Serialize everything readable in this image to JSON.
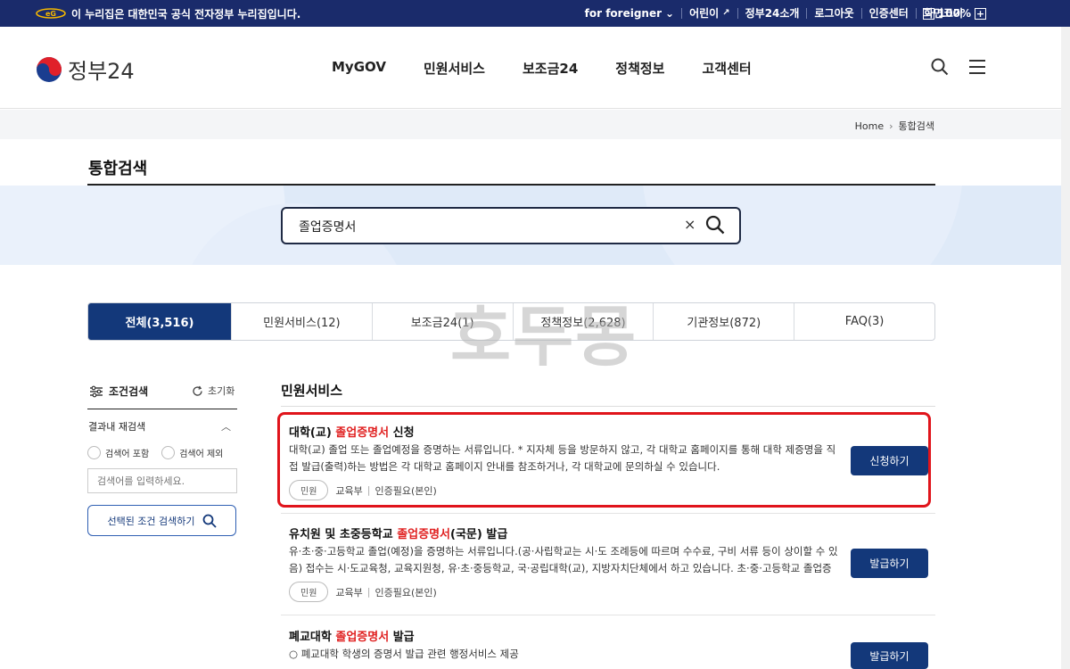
{
  "topbar": {
    "notice": "이 누리집은 대한민국 공식 전자정부 누리집입니다.",
    "links": [
      "for foreigner",
      "어린이",
      "정부24소개",
      "로그아웃",
      "인증센터",
      "화면크기"
    ],
    "zoom_minus": "−",
    "zoom_value": "100%",
    "zoom_plus": "+"
  },
  "header": {
    "logo_text": "정부24",
    "nav": [
      "MyGOV",
      "민원서비스",
      "보조금24",
      "정책정보",
      "고객센터"
    ]
  },
  "breadcrumb": [
    "Home",
    "통합검색"
  ],
  "page_title": "통합검색",
  "search": {
    "value": "졸업증명서",
    "clear": "×"
  },
  "tabs": [
    {
      "label": "전체(3,516)",
      "active": true
    },
    {
      "label": "민원서비스(12)",
      "active": false
    },
    {
      "label": "보조금24(1)",
      "active": false
    },
    {
      "label": "정책정보(2,628)",
      "active": false
    },
    {
      "label": "기관정보(872)",
      "active": false
    },
    {
      "label": "FAQ(3)",
      "active": false
    }
  ],
  "watermark": "호두몽",
  "sidebar": {
    "heading": "조건검색",
    "reset": "초기화",
    "subheading": "결과내 재검색",
    "option_include": "검색어 포함",
    "option_exclude": "검색어 제외",
    "input_placeholder": "검색어를 입력하세요.",
    "submit": "선택된 조건 검색하기"
  },
  "results": {
    "heading": "민원서비스",
    "items": [
      {
        "title_pre": "대학(교) ",
        "title_hl": "졸업증명서",
        "title_post": " 신청",
        "desc": "대학(교) 졸업 또는 졸업예정을 증명하는 서류입니다. * 지자체 등을 방문하지 않고, 각 대학교 홈페이지를 통해 대학 제증명을 직접 발급(출력)하는 방법은 각 대학교 홈페이지 안내를 참조하거나, 각 대학교에 문의하실 수 있습니다.",
        "badge": "민원",
        "org": "교육부",
        "auth": "인증필요(본인)",
        "button": "신청하기"
      },
      {
        "title_pre": "유치원 및 초중등학교 ",
        "title_hl": "졸업증명서",
        "title_post": "(국문) 발급",
        "desc": "유·초·중·고등학교 졸업(예정)을 증명하는 서류입니다.(공·사립학교는 시·도 조례등에 따르며 수수료, 구비 서류 등이 상이할 수 있음) 접수는 시·도교육청, 교육지원청, 유·초·중등학교, 국·공립대학(교), 지방자치단체에서 하고 있습니다. 초·중·고등학교 졸업증명은 ...",
        "badge": "민원",
        "org": "교육부",
        "auth": "인증필요(본인)",
        "button": "발급하기"
      },
      {
        "title_pre": "폐교대학 ",
        "title_hl": "졸업증명서",
        "title_post": " 발급",
        "desc": "○ 폐교대학 학생의 증명서 발급 관련 행정서비스 제공",
        "button": "발급하기"
      }
    ]
  },
  "colors": {
    "navy": "#13387a",
    "topbar": "#1a2b6b",
    "highlight": "#e02121",
    "band": "#dfeaf8"
  }
}
